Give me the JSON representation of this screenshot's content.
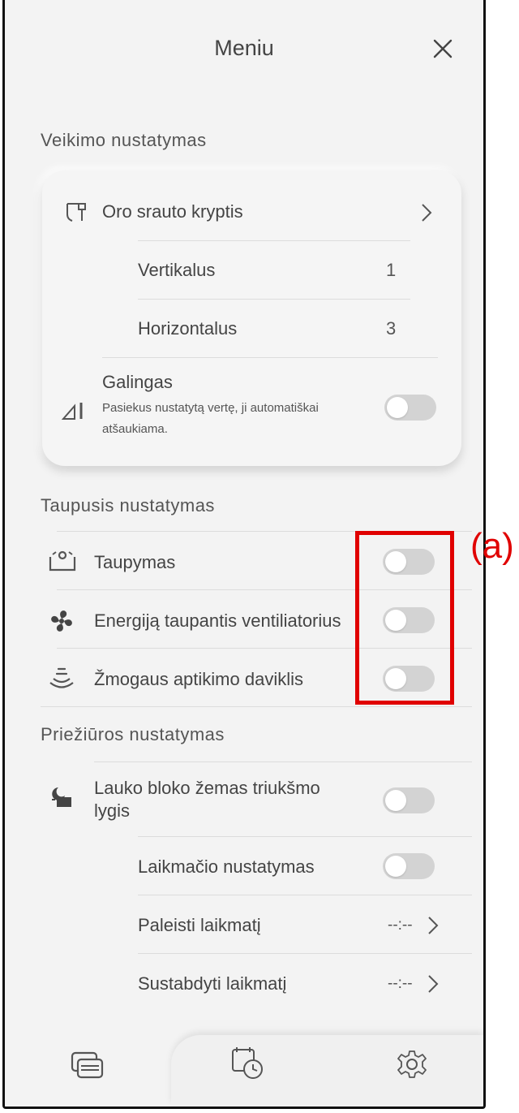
{
  "header": {
    "title": "Meniu"
  },
  "operation": {
    "section_title": "Veikimo nustatymas",
    "airflow": {
      "label": "Oro srauto kryptis"
    },
    "vertical": {
      "label": "Vertikalus",
      "value": "1"
    },
    "horizontal": {
      "label": "Horizontalus",
      "value": "3"
    },
    "powerful": {
      "label": "Galingas",
      "description": "Pasiekus nustatytą vertę, ji automatiškai atšaukiama."
    }
  },
  "economy": {
    "section_title": "Taupusis nustatymas",
    "items": [
      {
        "label": "Taupymas",
        "icon": "economy-icon",
        "on": false
      },
      {
        "label": "Energiją taupantis ventiliatorius",
        "icon": "fan-icon",
        "on": false
      },
      {
        "label": "Žmogaus aptikimo daviklis",
        "icon": "sensor-icon",
        "on": false
      }
    ]
  },
  "maintenance": {
    "section_title": "Priežiūros nustatymas",
    "quiet": {
      "label_line1": "Lauko bloko žemas triukšmo",
      "label_line2": "lygis"
    },
    "timer": {
      "label": "Laikmačio nustatymas"
    },
    "start": {
      "label": "Paleisti laikmatį",
      "value": "--:--"
    },
    "stop": {
      "label": "Sustabdyti laikmatį",
      "value": "--:--"
    }
  },
  "annotation": {
    "label": "(a)",
    "color": "#e00000"
  },
  "tabs": [
    {
      "icon": "device-icon"
    },
    {
      "icon": "timer-icon"
    },
    {
      "icon": "settings-icon"
    }
  ]
}
